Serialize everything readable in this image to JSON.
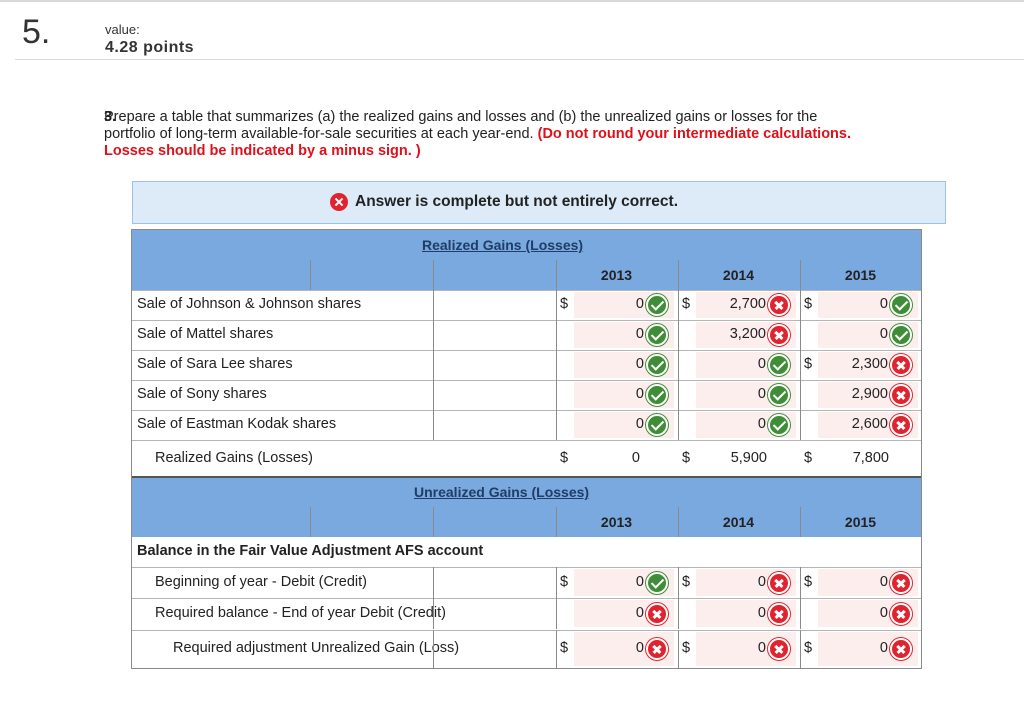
{
  "question_number": "5.",
  "value_label": "value:",
  "points": "4.28 points",
  "prompt": {
    "number": "3.",
    "text": "Prepare a table that summarizes (a) the realized gains and losses and (b) the unrealized gains or losses for the portfolio of long-term available-for-sale securities at each year-end.",
    "instruction": "(Do not round your intermediate calculations. Losses should be indicated by a minus sign. )"
  },
  "answer_status": "Answer is complete but not entirely correct.",
  "realized": {
    "title": "Realized Gains (Losses)",
    "years": [
      "2013",
      "2014",
      "2015"
    ],
    "rows": [
      {
        "label": "Sale of Johnson & Johnson shares",
        "values": [
          "0",
          "2,700",
          "0"
        ],
        "status": [
          "correct",
          "incorrect",
          "correct"
        ],
        "dollar": [
          true,
          true,
          true
        ]
      },
      {
        "label": "Sale of Mattel shares",
        "values": [
          "0",
          "3,200",
          "0"
        ],
        "status": [
          "correct",
          "incorrect",
          "correct"
        ],
        "dollar": [
          false,
          false,
          false
        ]
      },
      {
        "label": "Sale of Sara Lee shares",
        "values": [
          "0",
          "0",
          "2,300"
        ],
        "status": [
          "correct",
          "correct",
          "incorrect"
        ],
        "dollar": [
          false,
          false,
          true
        ]
      },
      {
        "label": "Sale of Sony shares",
        "values": [
          "0",
          "0",
          "2,900"
        ],
        "status": [
          "correct",
          "correct",
          "incorrect"
        ],
        "dollar": [
          false,
          false,
          false
        ]
      },
      {
        "label": "Sale of Eastman Kodak shares",
        "values": [
          "0",
          "0",
          "2,600"
        ],
        "status": [
          "correct",
          "correct",
          "incorrect"
        ],
        "dollar": [
          false,
          false,
          false
        ]
      }
    ],
    "total": {
      "label": "Realized Gains (Losses)",
      "values": [
        "0",
        "5,900",
        "7,800"
      ]
    }
  },
  "unrealized": {
    "title": "Unrealized Gains (Losses)",
    "years": [
      "2013",
      "2014",
      "2015"
    ],
    "section_label": "Balance in the Fair Value Adjustment AFS account",
    "rows": [
      {
        "label": "Beginning of year - Debit (Credit)",
        "values": [
          "0",
          "0",
          "0"
        ],
        "status": [
          "correct",
          "incorrect",
          "incorrect"
        ],
        "dollar": [
          true,
          true,
          true
        ]
      },
      {
        "label": "Required balance - End of year Debit (Credit)",
        "values": [
          "0",
          "0",
          "0"
        ],
        "status": [
          "incorrect",
          "incorrect",
          "incorrect"
        ],
        "dollar": [
          false,
          false,
          false
        ]
      },
      {
        "label": "Required adjustment Unrealized Gain (Loss)",
        "values": [
          "0",
          "0",
          "0"
        ],
        "status": [
          "incorrect",
          "incorrect",
          "incorrect"
        ],
        "dollar": [
          true,
          true,
          true
        ]
      }
    ]
  },
  "currency_symbol": "$",
  "colors": {
    "header_blue": "#7aa9e0",
    "answer_bg": "#dcebf7",
    "correct": "#3f8e37",
    "incorrect": "#e0232e",
    "instruction_red": "#e0101a"
  }
}
